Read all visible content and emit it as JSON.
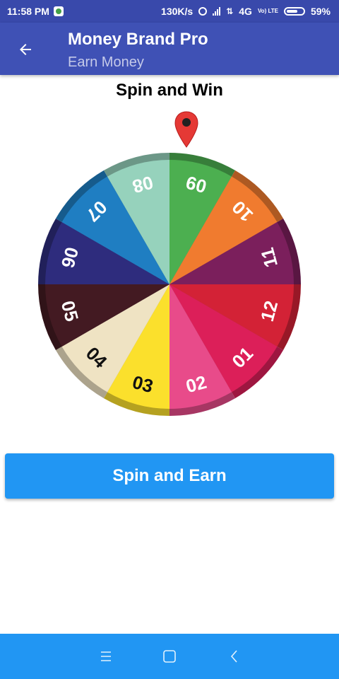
{
  "status_bar": {
    "time": "11:58 PM",
    "speed": "130K/s",
    "network": "4G",
    "volte": "Vo) LTE",
    "battery": "59%",
    "icons": [
      "whatsapp-icon",
      "alarm-icon",
      "signal-icon",
      "data-arrows-icon",
      "volte-icon",
      "battery-icon"
    ]
  },
  "app_bar": {
    "title": "Money Brand Pro",
    "subtitle": "Earn Money",
    "back_icon": "arrow-left-icon",
    "color": "#3f51b5"
  },
  "wheel": {
    "title": "Spin and Win",
    "pointer_icon": "location-pin-icon",
    "segments": [
      {
        "label": "09",
        "color": "#4caf50"
      },
      {
        "label": "10",
        "color": "#f07b2f"
      },
      {
        "label": "11",
        "color": "#7b1f5c"
      },
      {
        "label": "12",
        "color": "#d32236"
      },
      {
        "label": "01",
        "color": "#dc1f59"
      },
      {
        "label": "02",
        "color": "#e84b8a"
      },
      {
        "label": "03",
        "color": "#fbe02c"
      },
      {
        "label": "04",
        "color": "#efe3c3"
      },
      {
        "label": "05",
        "color": "#431a22"
      },
      {
        "label": "06",
        "color": "#2e2c7d"
      },
      {
        "label": "07",
        "color": "#1f7ec2"
      },
      {
        "label": "08",
        "color": "#96d2bc"
      }
    ]
  },
  "spin_button": {
    "label": "Spin and Earn",
    "color": "#2196f3"
  },
  "nav_bar": {
    "icons": [
      "menu-icon",
      "home-square-icon",
      "back-chevron-icon"
    ],
    "color": "#2196f3"
  }
}
